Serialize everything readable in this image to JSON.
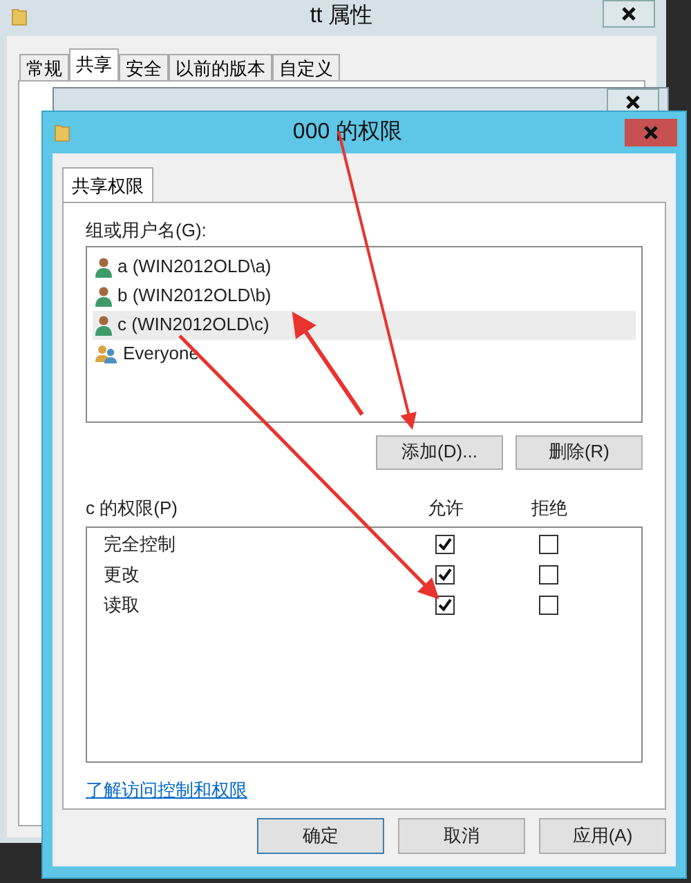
{
  "back_window": {
    "title": "tt 属性",
    "tabs": [
      {
        "label": "常规",
        "selected": false
      },
      {
        "label": "共享",
        "selected": true
      },
      {
        "label": "安全",
        "selected": false
      },
      {
        "label": "以前的版本",
        "selected": false
      },
      {
        "label": "自定义",
        "selected": false
      }
    ]
  },
  "window": {
    "title": "000 的权限",
    "tabs": [
      {
        "label": "共享权限",
        "selected": true
      }
    ],
    "group_label": "组或用户名(G):",
    "users": [
      {
        "name": "a (WIN2012OLD\\a)",
        "kind": "user",
        "selected": false
      },
      {
        "name": "b (WIN2012OLD\\b)",
        "kind": "user",
        "selected": false
      },
      {
        "name": "c (WIN2012OLD\\c)",
        "kind": "user",
        "selected": true
      },
      {
        "name": "Everyone",
        "kind": "group",
        "selected": false
      }
    ],
    "list_buttons": [
      "添加(D)...",
      "删除(R)"
    ],
    "permissions_label": "c 的权限(P)",
    "columns": [
      "允许",
      "拒绝"
    ],
    "permissions": [
      {
        "name": "完全控制",
        "allow": true,
        "deny": false
      },
      {
        "name": "更改",
        "allow": true,
        "deny": false
      },
      {
        "name": "读取",
        "allow": true,
        "deny": false
      }
    ],
    "link": "了解访问控制和权限",
    "footer_buttons": [
      "确定",
      "取消",
      "应用(A)"
    ]
  }
}
